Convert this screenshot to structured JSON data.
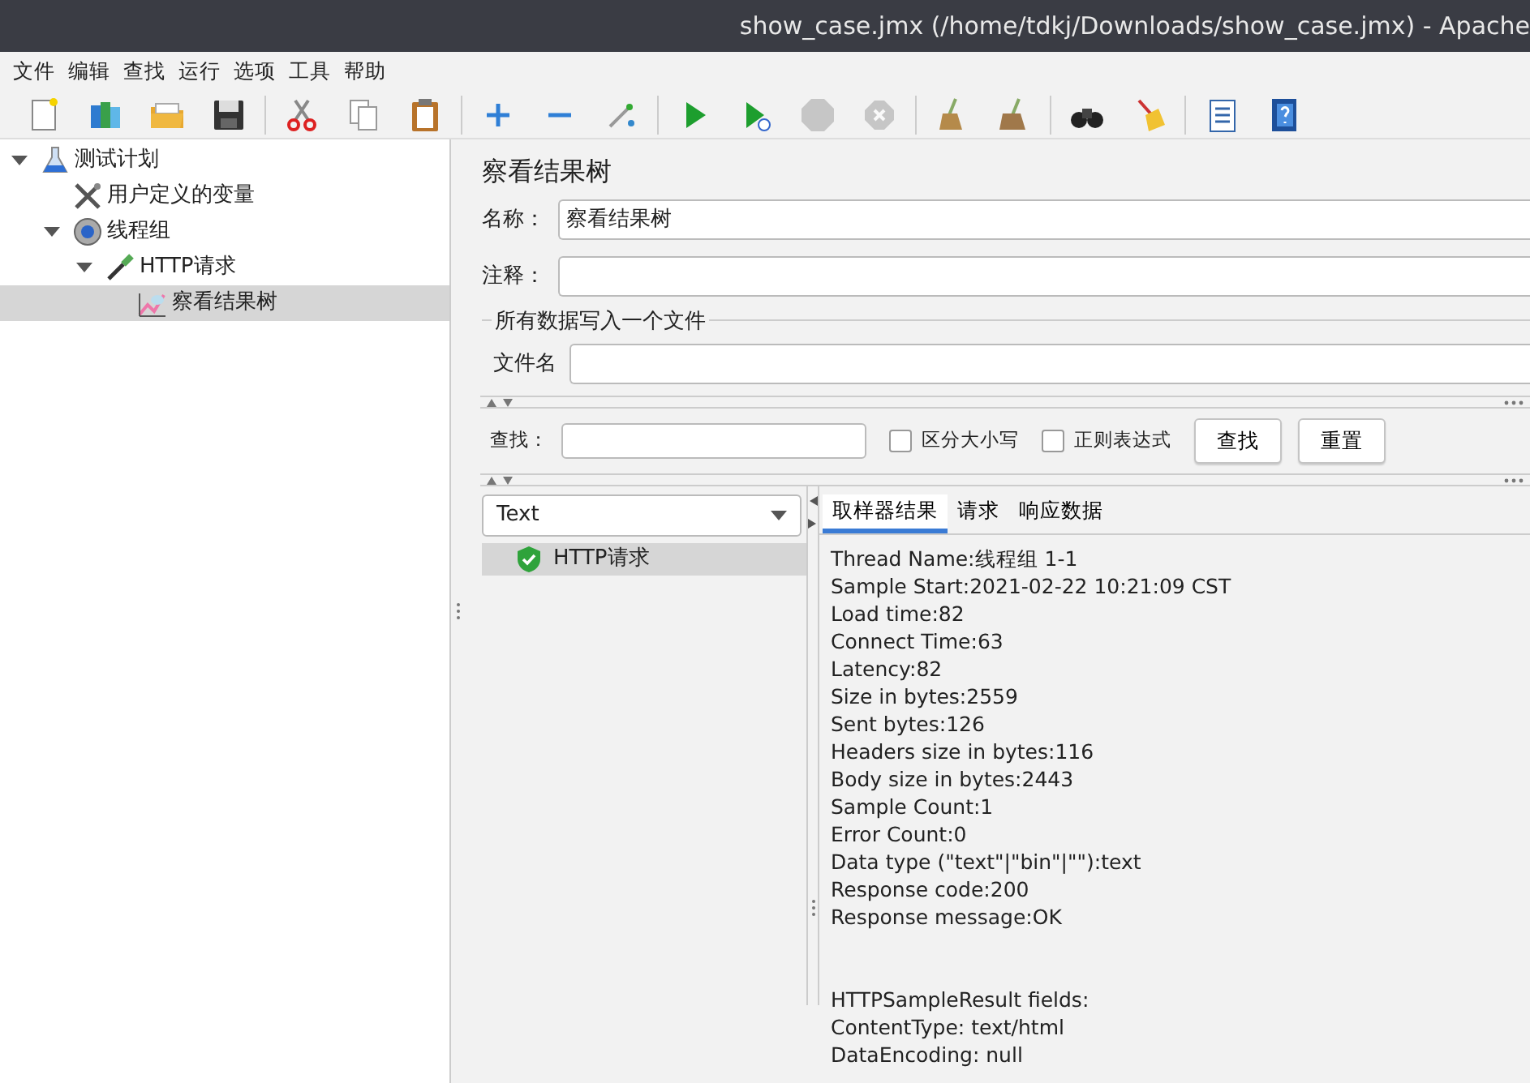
{
  "window": {
    "title": "show_case.jmx (/home/tdkj/Downloads/show_case.jmx) - Apache"
  },
  "menu": [
    "文件",
    "编辑",
    "查找",
    "运行",
    "选项",
    "工具",
    "帮助"
  ],
  "toolbar": [
    {
      "kind": "new",
      "disabled": false
    },
    {
      "kind": "templates",
      "disabled": false
    },
    {
      "kind": "open",
      "disabled": false
    },
    {
      "kind": "save",
      "disabled": false
    },
    {
      "kind": "separator"
    },
    {
      "kind": "cut",
      "disabled": false
    },
    {
      "kind": "copy",
      "disabled": false
    },
    {
      "kind": "paste",
      "disabled": false
    },
    {
      "kind": "separator"
    },
    {
      "kind": "expand",
      "disabled": false
    },
    {
      "kind": "collapse",
      "disabled": false
    },
    {
      "kind": "toggle",
      "disabled": false
    },
    {
      "kind": "separator"
    },
    {
      "kind": "start",
      "disabled": false
    },
    {
      "kind": "start-no-pause",
      "disabled": false
    },
    {
      "kind": "stop",
      "disabled": true
    },
    {
      "kind": "shutdown",
      "disabled": true
    },
    {
      "kind": "separator"
    },
    {
      "kind": "clear",
      "disabled": false
    },
    {
      "kind": "clear-all",
      "disabled": false
    },
    {
      "kind": "separator"
    },
    {
      "kind": "search",
      "disabled": false
    },
    {
      "kind": "reset-search",
      "disabled": false
    },
    {
      "kind": "separator"
    },
    {
      "kind": "functions",
      "disabled": false
    },
    {
      "kind": "help",
      "disabled": false
    }
  ],
  "tree": [
    {
      "label": "测试计划",
      "kind": "plan",
      "expanded": true,
      "selected": false,
      "children": [
        {
          "label": "用户定义的变量",
          "kind": "config",
          "selected": false
        },
        {
          "label": "线程组",
          "kind": "threadgroup",
          "expanded": true,
          "selected": false,
          "children": [
            {
              "label": "HTTP请求",
              "kind": "sampler",
              "expanded": true,
              "selected": false,
              "children": [
                {
                  "label": "察看结果树",
                  "kind": "listener",
                  "selected": true
                }
              ]
            }
          ]
        }
      ]
    }
  ],
  "panel": {
    "title": "察看结果树",
    "name_label": "名称：",
    "name_value": "察看结果树",
    "comment_label": "注释：",
    "file_group": "所有数据写入一个文件",
    "filename_label": "文件名",
    "search_label": "查找：",
    "checkboxes": [
      {
        "label": "区分大小写",
        "checked": false
      },
      {
        "label": "正则表达式",
        "checked": false
      }
    ],
    "buttons": [
      "查找",
      "重置"
    ],
    "renderer": "Text",
    "results": [
      {
        "label": "HTTP请求",
        "passed": true,
        "selected": true
      }
    ],
    "tabs": [
      {
        "label": "取样器结果",
        "selected": true
      },
      {
        "label": "请求",
        "selected": false
      },
      {
        "label": "响应数据",
        "selected": false
      }
    ],
    "result_sections": [
      [
        "Thread Name:线程组 1-1",
        "Sample Start:2021-02-22 10:21:09 CST",
        "Load time:82",
        "Connect Time:63",
        "Latency:82",
        "Size in bytes:2559",
        "Sent bytes:126",
        "Headers size in bytes:116",
        "Body size in bytes:2443",
        "Sample Count:1",
        "Error Count:0",
        "Data type (\"text\"|\"bin\"|\"\"):text",
        "Response code:200",
        "Response message:OK"
      ],
      [
        "HTTPSampleResult fields:",
        "ContentType: text/html",
        "DataEncoding: null"
      ]
    ]
  }
}
